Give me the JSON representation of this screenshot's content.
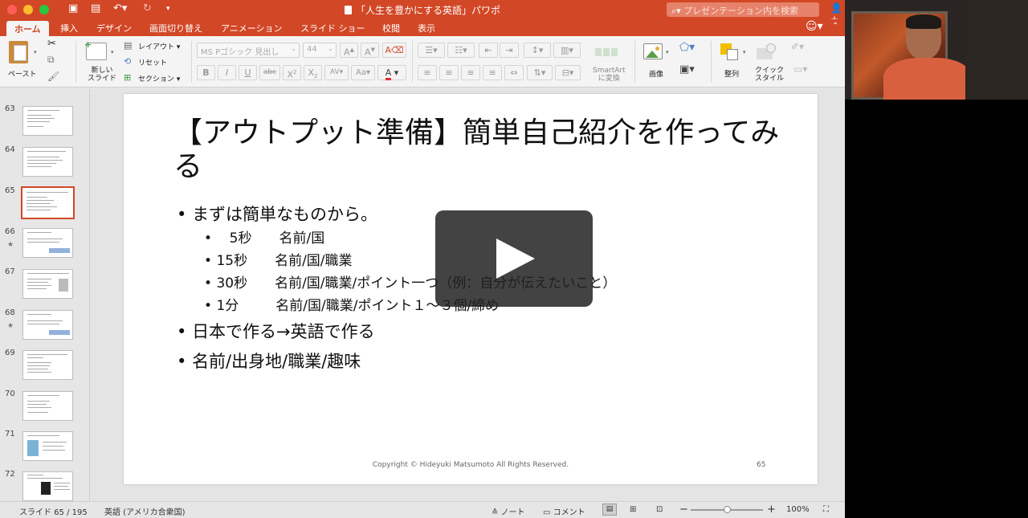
{
  "titlebar": {
    "title": "「人生を豊かにする英語」パワポ",
    "search_placeholder": "プレゼンテーション内を検索"
  },
  "tabs": [
    {
      "label": "ホーム",
      "active": true
    },
    {
      "label": "挿入"
    },
    {
      "label": "デザイン"
    },
    {
      "label": "画面切り替え"
    },
    {
      "label": "アニメーション"
    },
    {
      "label": "スライド ショー"
    },
    {
      "label": "校閲"
    },
    {
      "label": "表示"
    }
  ],
  "ribbon": {
    "paste": "ペースト",
    "new_slide": "新しい\nスライド",
    "new_slide_l1": "新しい",
    "new_slide_l2": "スライド",
    "layout": "レイアウト",
    "reset": "リセット",
    "section": "セクション",
    "font_name": "MS Pゴシック 見出し",
    "font_size": "44",
    "smartart_l1": "SmartArt",
    "smartart_l2": "に変換",
    "image": "画像",
    "arrange": "整列",
    "quick_style_l1": "クイック",
    "quick_style_l2": "スタイル"
  },
  "thumbnails": [
    {
      "num": "63",
      "star": false
    },
    {
      "num": "64",
      "star": false
    },
    {
      "num": "65",
      "star": false,
      "selected": true
    },
    {
      "num": "66",
      "star": true
    },
    {
      "num": "67",
      "star": false
    },
    {
      "num": "68",
      "star": true
    },
    {
      "num": "69",
      "star": false
    },
    {
      "num": "70",
      "star": false
    },
    {
      "num": "71",
      "star": false
    },
    {
      "num": "72",
      "star": false
    }
  ],
  "slide": {
    "title": "【アウトプット準備】簡単自己紹介を作ってみる",
    "bullets": [
      "まずは簡単なものから。",
      "日本で作る→英語で作る",
      "名前/出身地/職業/趣味"
    ],
    "subbullets": [
      {
        "time": "5秒",
        "text": "名前/国"
      },
      {
        "time": "15秒",
        "text": "名前/国/職業"
      },
      {
        "time": "30秒",
        "text": "名前/国/職業/ポイント一つ（例：自分が伝えたいこと）"
      },
      {
        "time": "1分",
        "text": "名前/国/職業/ポイント１～３個/締め"
      }
    ],
    "copyright": "Copyright © Hideyuki Matsumoto All Rights Reserved.",
    "page_number": "65"
  },
  "status": {
    "slide_count": "スライド 65 / 195",
    "language": "英語 (アメリカ合衆国)",
    "notes": "ノート",
    "comments": "コメント",
    "zoom": "100%"
  },
  "colors": {
    "accent": "#d24726"
  }
}
